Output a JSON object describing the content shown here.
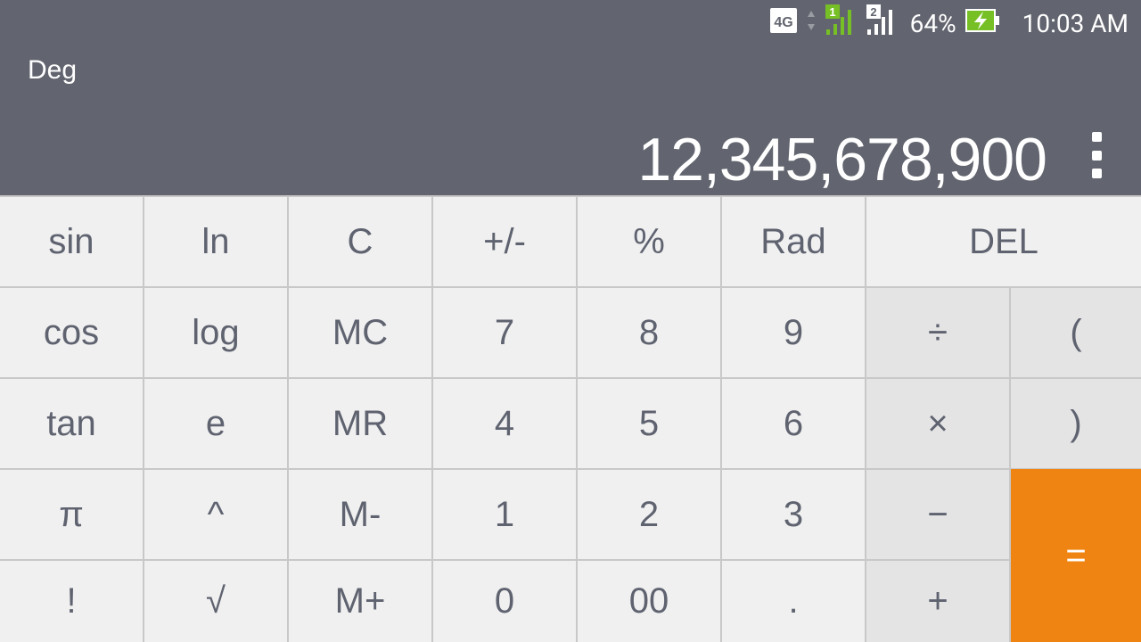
{
  "status_bar": {
    "network": "4G",
    "sim1": "1",
    "sim2": "2",
    "battery": "64%",
    "time": "10:03 AM"
  },
  "mode": "Deg",
  "display": "12,345,678,900",
  "keys": {
    "sin": "sin",
    "ln": "ln",
    "c": "C",
    "plus_minus": "+/-",
    "percent": "%",
    "rad": "Rad",
    "del": "DEL",
    "cos": "cos",
    "log": "log",
    "mc": "MC",
    "seven": "7",
    "eight": "8",
    "nine": "9",
    "divide": "÷",
    "lparen": "(",
    "tan": "tan",
    "e": "e",
    "mr": "MR",
    "four": "4",
    "five": "5",
    "six": "6",
    "multiply": "×",
    "rparen": ")",
    "pi": "π",
    "power": "^",
    "m_minus": "M-",
    "one": "1",
    "two": "2",
    "three": "3",
    "minus": "−",
    "equals": "=",
    "factorial": "!",
    "sqrt": "√",
    "m_plus": "M+",
    "zero": "0",
    "double_zero": "00",
    "decimal": ".",
    "plus": "+"
  },
  "colors": {
    "header": "#62656f",
    "key_bg": "#f0f0f0",
    "operator_bg": "#e4e4e4",
    "equals_bg": "#ef8412",
    "key_text": "#5f6370"
  }
}
